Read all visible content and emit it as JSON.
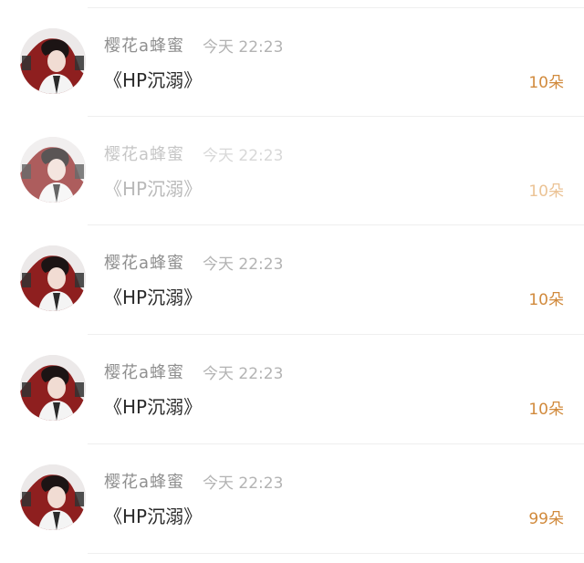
{
  "list": {
    "items": [
      {
        "name": "樱花a蜂蜜",
        "time": "今天 22:23",
        "message": "《HP沉溺》",
        "count": "10朵",
        "avatar_icon": "user-avatar-icon",
        "faded": false
      },
      {
        "name": "樱花a蜂蜜",
        "time": "今天 22:23",
        "message": "《HP沉溺》",
        "count": "10朵",
        "avatar_icon": "user-avatar-icon",
        "faded": true
      },
      {
        "name": "樱花a蜂蜜",
        "time": "今天 22:23",
        "message": "《HP沉溺》",
        "count": "10朵",
        "avatar_icon": "user-avatar-icon",
        "faded": false
      },
      {
        "name": "樱花a蜂蜜",
        "time": "今天 22:23",
        "message": "《HP沉溺》",
        "count": "10朵",
        "avatar_icon": "user-avatar-icon",
        "faded": false
      },
      {
        "name": "樱花a蜂蜜",
        "time": "今天 22:23",
        "message": "《HP沉溺》",
        "count": "99朵",
        "avatar_icon": "user-avatar-icon",
        "faded": false
      }
    ]
  },
  "colors": {
    "accent": "#d18a3c",
    "divider": "#efefef",
    "name_text": "#8f8f8f",
    "message_text": "#2a2a2a"
  }
}
